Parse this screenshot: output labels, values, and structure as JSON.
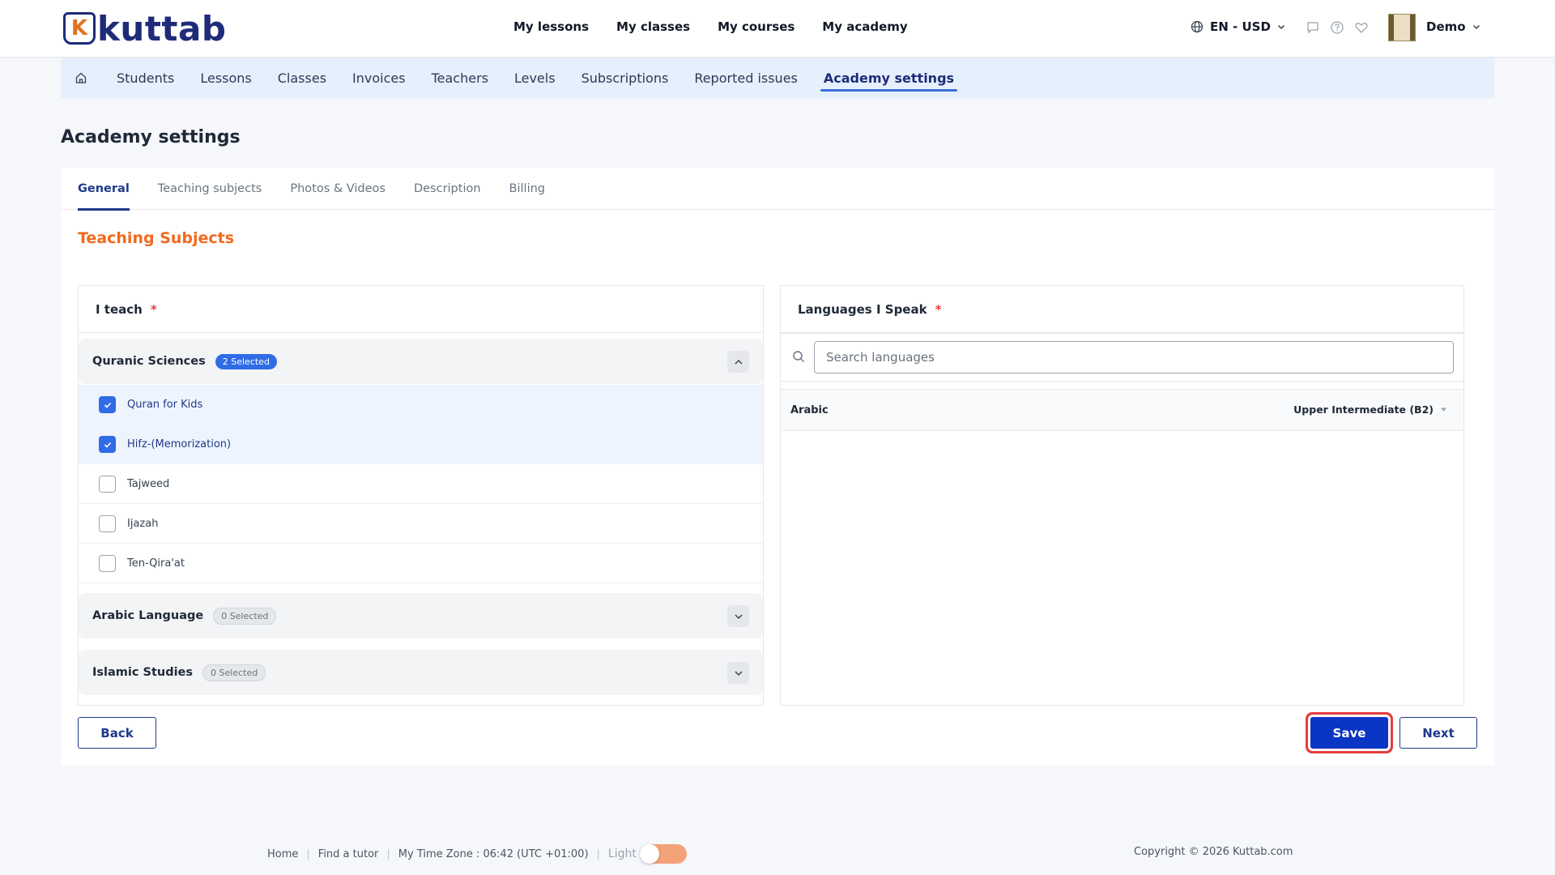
{
  "header": {
    "logo_letter": "K",
    "logo_text": "kuttab",
    "nav": [
      "My lessons",
      "My classes",
      "My courses",
      "My academy"
    ],
    "locale": "EN - USD",
    "user_name": "Demo"
  },
  "subnav": {
    "items": [
      "Students",
      "Lessons",
      "Classes",
      "Invoices",
      "Teachers",
      "Levels",
      "Subscriptions",
      "Reported issues",
      "Academy settings"
    ],
    "active": "Academy settings"
  },
  "page_title": "Academy settings",
  "tabs": [
    "General",
    "Teaching subjects",
    "Photos & Videos",
    "Description",
    "Billing"
  ],
  "active_tab": "General",
  "section_title": "Teaching Subjects",
  "i_teach": {
    "label": "I teach",
    "required_mark": "*",
    "groups": [
      {
        "title": "Quranic Sciences",
        "badge": "2 Selected",
        "expanded": true,
        "items": [
          {
            "label": "Quran for Kids",
            "checked": true
          },
          {
            "label": "Hifz-(Memorization)",
            "checked": true
          },
          {
            "label": "Tajweed",
            "checked": false
          },
          {
            "label": "Ijazah",
            "checked": false
          },
          {
            "label": "Ten-Qira'at",
            "checked": false
          }
        ]
      },
      {
        "title": "Arabic Language",
        "badge": "0 Selected",
        "expanded": false
      },
      {
        "title": "Islamic Studies",
        "badge": "0 Selected",
        "expanded": false
      }
    ]
  },
  "languages": {
    "label": "Languages I Speak",
    "required_mark": "*",
    "search_placeholder": "Search languages",
    "rows": [
      {
        "name": "Arabic",
        "level": "Upper Intermediate (B2)"
      }
    ]
  },
  "buttons": {
    "back": "Back",
    "save": "Save",
    "next": "Next"
  },
  "footer": {
    "links": [
      "Home",
      "Find a tutor"
    ],
    "timezone": "My Time Zone : 06:42 (UTC +01:00)",
    "theme_label": "Light",
    "copyright": "Copyright © 2026 Kuttab.com"
  },
  "colors": {
    "accent": "#f06a1d",
    "primary": "#0b35c4",
    "checkbox": "#2f6ce5"
  }
}
